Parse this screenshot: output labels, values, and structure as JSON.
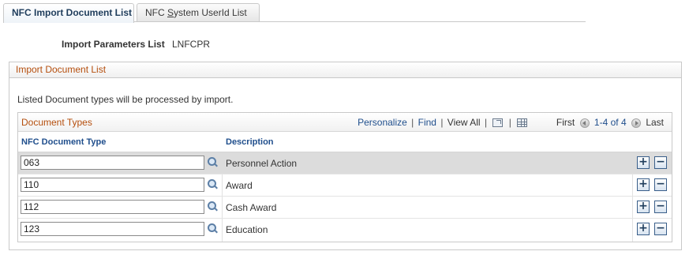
{
  "tabs": [
    {
      "label": "NFC Import Document List",
      "active": true
    },
    {
      "label_prefix": "NFC ",
      "label_underlined": "S",
      "label_suffix": "ystem UserId List",
      "active": false
    }
  ],
  "params": {
    "label": "Import Parameters List",
    "value": "LNFCPR"
  },
  "groupbox": {
    "title": "Import Document List",
    "instruction": "Listed Document types will be processed by import."
  },
  "grid": {
    "title": "Document Types",
    "nav": {
      "personalize": "Personalize",
      "find": "Find",
      "view_all": "View All",
      "first": "First",
      "count": "1-4 of 4",
      "last": "Last"
    },
    "columns": {
      "type": "NFC Document Type",
      "description": "Description"
    },
    "rows": [
      {
        "type": "063",
        "description": "Personnel Action",
        "selected": true
      },
      {
        "type": "110",
        "description": "Award",
        "selected": false
      },
      {
        "type": "112",
        "description": "Cash Award",
        "selected": false
      },
      {
        "type": "123",
        "description": "Education",
        "selected": false
      }
    ],
    "buttons": {
      "add": "+",
      "delete": "−"
    }
  },
  "colors": {
    "accent_text": "#b54f0e",
    "link": "#1f4e8c",
    "selected_row": "#dcdcdc"
  },
  "icons": [
    "lookup-icon",
    "zoom-icon",
    "download-grid-icon",
    "prev-icon",
    "next-icon"
  ]
}
